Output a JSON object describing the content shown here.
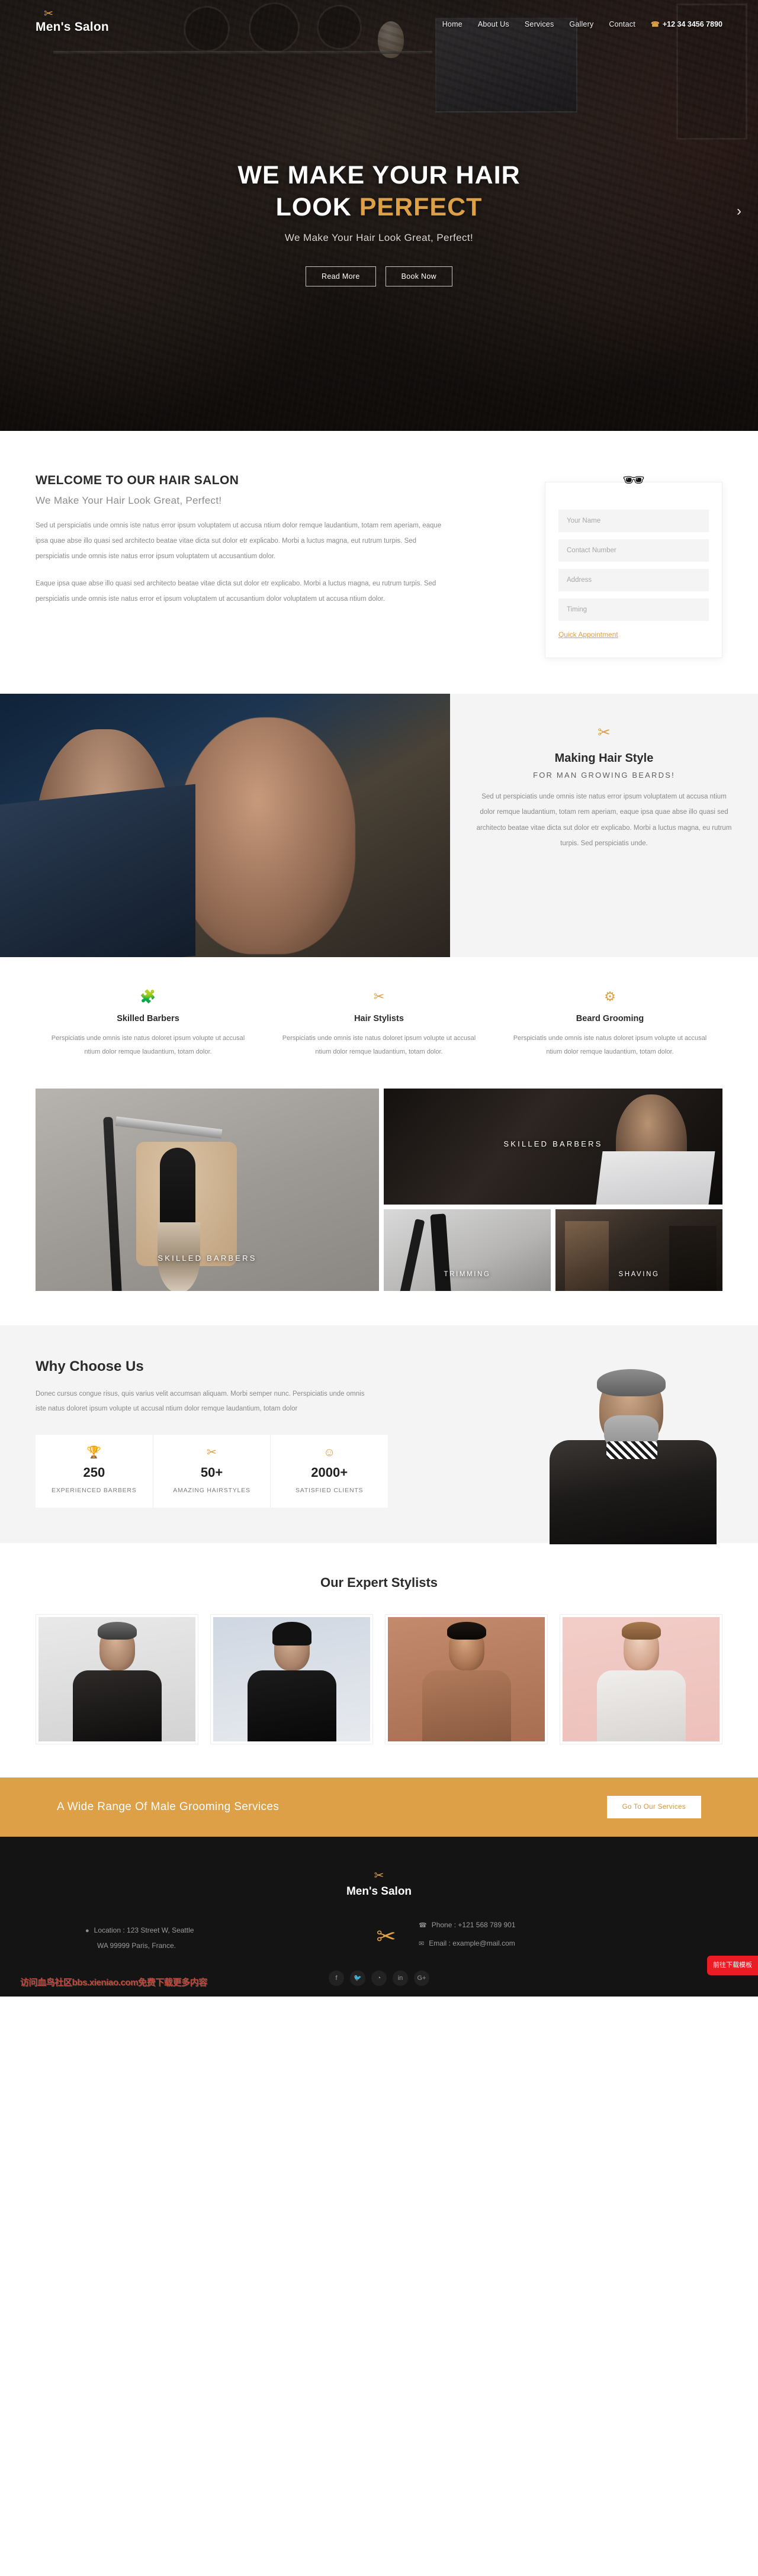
{
  "brand": {
    "name": "Men's Salon",
    "icon": "scissors-icon"
  },
  "nav": {
    "items": [
      "Home",
      "About Us",
      "Services",
      "Gallery",
      "Contact"
    ],
    "phone": "+12 34 3456 7890",
    "phone_icon": "phone-icon"
  },
  "hero": {
    "title_line1": "WE MAKE YOUR HAIR",
    "title_line2_plain": "LOOK",
    "title_line2_accent": "PERFECT",
    "subtitle": "We Make Your Hair Look Great, Perfect!",
    "btn_primary": "Read More",
    "btn_secondary": "Book Now",
    "next_arrow": "›"
  },
  "welcome": {
    "title": "WELCOME TO OUR HAIR SALON",
    "subtitle": "We Make Your Hair Look Great, Perfect!",
    "paragraph1": "Sed ut perspiciatis unde omnis iste natus error ipsum voluptatem ut accusa ntium dolor remque laudantium, totam rem aperiam, eaque ipsa quae abse illo quasi sed architecto beatae vitae dicta sut dolor etr explicabo. Morbi a luctus magna, eut rutrum turpis. Sed perspiciatis unde omnis iste natus error ipsum voluptatem ut accusantium dolor.",
    "paragraph2": "Eaque ipsa quae abse illo quasi sed architecto beatae vitae dicta sut dolor etr explicabo. Morbi a luctus magna, eu rutrum turpis. Sed perspiciatis unde omnis iste natus error et ipsum voluptatem ut accusantium dolor voluptatem ut accusa ntium dolor."
  },
  "appointment_form": {
    "moustache_icon": "moustache-icon",
    "name_placeholder": "Your Name",
    "contact_placeholder": "Contact Number",
    "address_placeholder": "Address",
    "timing_placeholder": "Timing",
    "name_value": "",
    "contact_value": "",
    "address_value": "",
    "timing_value": "",
    "submit_label": "Quick Appointment"
  },
  "hairstyle": {
    "icon": "scissors-icon",
    "title": "Making Hair Style",
    "subtitle": "FOR MAN GROWING BEARDS!",
    "paragraph": "Sed ut perspiciatis unde omnis iste natus error ipsum voluptatem ut accusa ntium dolor remque laudantium, totam rem aperiam, eaque ipsa quae abse illo quasi sed architecto beatae vitae dicta sut dolor etr explicabo. Morbi a luctus magna, eu rutrum turpis. Sed perspiciatis unde."
  },
  "services": [
    {
      "icon": "puzzle-icon",
      "title": "Skilled Barbers",
      "text": "Perspiciatis unde omnis iste natus doloret ipsum volupte ut accusal ntium dolor remque laudantium, totam dolor."
    },
    {
      "icon": "scissors-icon",
      "title": "Hair Stylists",
      "text": "Perspiciatis unde omnis iste natus doloret ipsum volupte ut accusal ntium dolor remque laudantium, totam dolor."
    },
    {
      "icon": "sliders-icon",
      "title": "Beard Grooming",
      "text": "Perspiciatis unde omnis iste natus doloret ipsum volupte ut accusal ntium dolor remque laudantium, totam dolor."
    }
  ],
  "gallery": {
    "big_caption": "SKILLED BARBERS",
    "top_caption": "SKILLED BARBERS",
    "trimming_caption": "TRIMMING",
    "shaving_caption": "SHAVING"
  },
  "why_choose": {
    "title": "Why Choose Us",
    "paragraph": "Donec cursus congue risus, quis varius velit accumsan aliquam. Morbi semper nunc. Perspiciatis unde omnis iste natus doloret ipsum volupte ut accusal ntium dolor remque laudantium, totam dolor",
    "stats": [
      {
        "icon": "trophy-icon",
        "number": "250",
        "label": "EXPERIENCED BARBERS"
      },
      {
        "icon": "scissors-icon",
        "number": "50+",
        "label": "AMAZING HAIRSTYLES"
      },
      {
        "icon": "smiley-icon",
        "number": "2000+",
        "label": "SATISFIED CLIENTS"
      }
    ]
  },
  "stylists": {
    "title": "Our Expert Stylists",
    "count": 4
  },
  "cta": {
    "text": "A Wide Range Of Male Grooming Services",
    "button": "Go To Our Services"
  },
  "footer": {
    "brand_icon": "scissors-icon",
    "brand_name": "Men's Salon",
    "center_icon": "big-scissors-icon",
    "location_icon": "map-pin-icon",
    "location_line1": "Location : 123 Street W, Seattle",
    "location_line2": "WA 99999 Paris, France.",
    "phone_icon": "phone-icon",
    "phone": "Phone : +121 568 789 901",
    "email_icon": "envelope-icon",
    "email": "Email : example@mail.com",
    "social": [
      {
        "icon": "facebook-icon",
        "glyph": "f"
      },
      {
        "icon": "twitter-icon",
        "glyph": "🐦"
      },
      {
        "icon": "rss-icon",
        "glyph": "◔"
      },
      {
        "icon": "linkedin-icon",
        "glyph": "in"
      },
      {
        "icon": "google-plus-icon",
        "glyph": "G+"
      }
    ]
  },
  "overlays": {
    "watermark": "访问血鸟社区bbs.xieniao.com免费下载更多内容",
    "download_badge": "前往下载模板"
  },
  "colors": {
    "accent": "#dda046",
    "dark": "#141414",
    "muted": "#8a8a8a",
    "light_bg": "#f4f4f4"
  }
}
